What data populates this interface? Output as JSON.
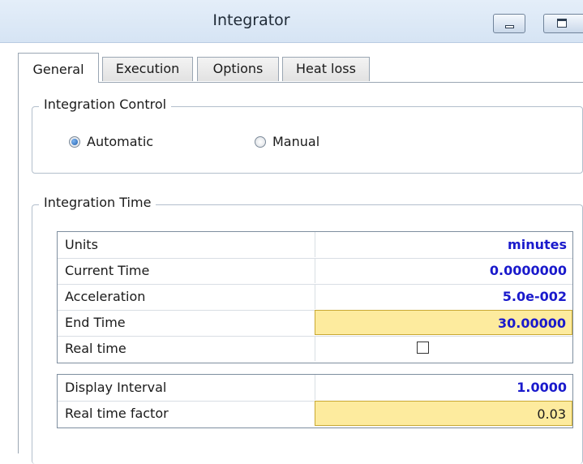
{
  "window": {
    "title": "Integrator"
  },
  "tabs": [
    "General",
    "Execution",
    "Options",
    "Heat loss"
  ],
  "integration_control": {
    "legend": "Integration Control",
    "options": [
      "Automatic",
      "Manual"
    ],
    "selected": "Automatic"
  },
  "integration_time": {
    "legend": "Integration Time",
    "rows": [
      {
        "label": "Units",
        "value": "minutes"
      },
      {
        "label": "Current Time",
        "value": "0.0000000"
      },
      {
        "label": "Acceleration",
        "value": "5.0e-002"
      },
      {
        "label": "End Time",
        "value": "30.00000"
      },
      {
        "label": "Real time",
        "value": "",
        "checked": false
      }
    ],
    "rows2": [
      {
        "label": "Display Interval",
        "value": "1.0000"
      },
      {
        "label": "Real time factor",
        "value": "0.03"
      }
    ]
  },
  "colors": {
    "value_text": "#1a1acc",
    "editable_cell": "#fdeb9e",
    "title_bar": "#d6e4f4"
  }
}
